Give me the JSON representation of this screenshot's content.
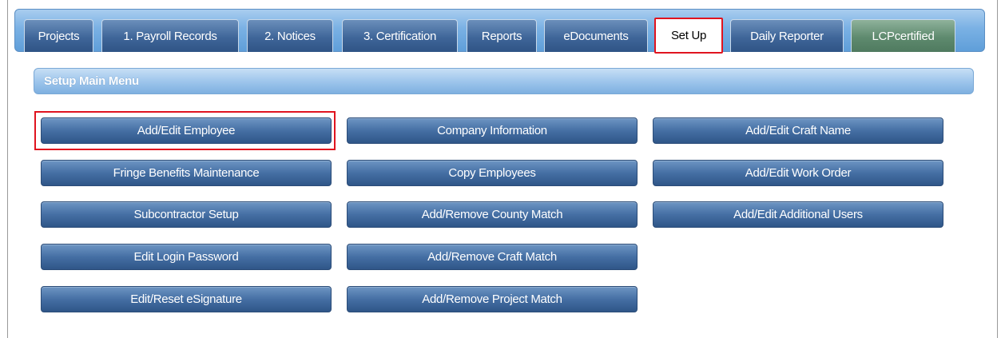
{
  "tabs": [
    {
      "label": "Projects"
    },
    {
      "label": "1. Payroll Records"
    },
    {
      "label": "2. Notices"
    },
    {
      "label": "3. Certification"
    },
    {
      "label": "Reports"
    },
    {
      "label": "eDocuments"
    },
    {
      "label": "Set Up"
    },
    {
      "label": "Daily Reporter"
    },
    {
      "label": "LCPcertified"
    }
  ],
  "section": {
    "title": "Setup Main Menu"
  },
  "buttons": {
    "add_edit_employee": "Add/Edit Employee",
    "company_information": "Company Information",
    "add_edit_craft_name": "Add/Edit Craft Name",
    "fringe_benefits_maintenance": "Fringe Benefits Maintenance",
    "copy_employees": "Copy Employees",
    "add_edit_work_order": "Add/Edit Work Order",
    "subcontractor_setup": "Subcontractor Setup",
    "add_remove_county_match": "Add/Remove County Match",
    "add_edit_additional_users": "Add/Edit Additional Users",
    "edit_login_password": "Edit Login Password",
    "add_remove_craft_match": "Add/Remove Craft Match",
    "edit_reset_esignature": "Edit/Reset eSignature",
    "add_remove_project_match": "Add/Remove Project Match"
  },
  "colors": {
    "tab_blue": "#3f6699",
    "tab_green": "#5e8a6e",
    "button_blue": "#456fa4",
    "highlight_red": "#e0141f"
  }
}
